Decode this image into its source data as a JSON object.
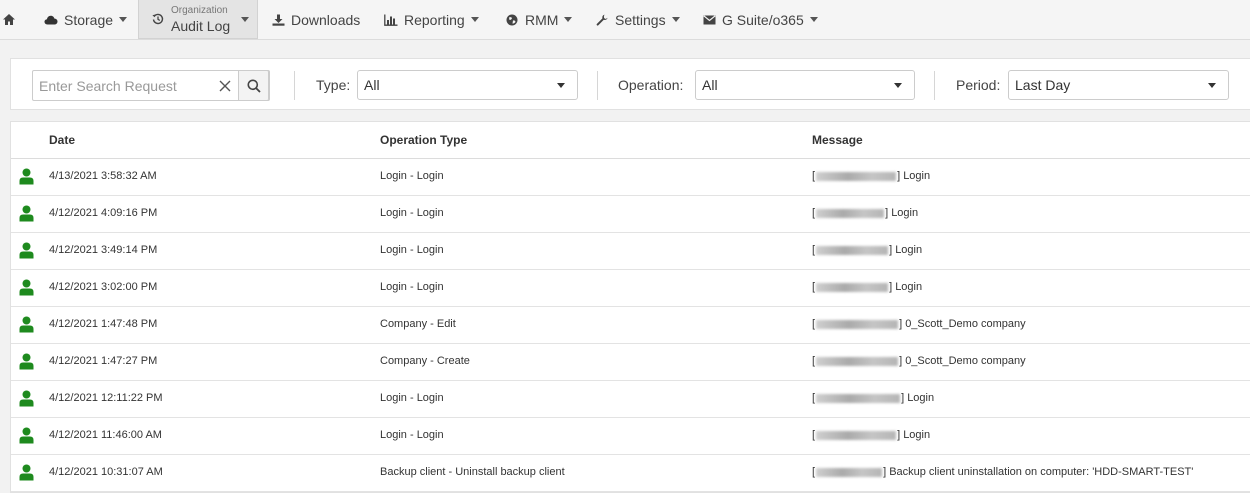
{
  "nav": {
    "storage": "Storage",
    "audit_log_top": "Organization",
    "audit_log_bottom": "Audit Log",
    "downloads": "Downloads",
    "reporting": "Reporting",
    "rmm": "RMM",
    "settings": "Settings",
    "gsuite": "G Suite/o365"
  },
  "filters": {
    "search_placeholder": "Enter Search Request",
    "search_value": "",
    "type_label": "Type:",
    "type_value": "All",
    "operation_label": "Operation:",
    "operation_value": "All",
    "period_label": "Period:",
    "period_value": "Last Day"
  },
  "table": {
    "headers": {
      "date": "Date",
      "operation": "Operation Type",
      "message": "Message"
    },
    "rows": [
      {
        "date": "4/13/2021 3:58:32 AM",
        "operation": "Login - Login",
        "message": "Login"
      },
      {
        "date": "4/12/2021 4:09:16 PM",
        "operation": "Login - Login",
        "message": "Login"
      },
      {
        "date": "4/12/2021 3:49:14 PM",
        "operation": "Login - Login",
        "message": "Login"
      },
      {
        "date": "4/12/2021 3:02:00 PM",
        "operation": "Login - Login",
        "message": "Login"
      },
      {
        "date": "4/12/2021 1:47:48 PM",
        "operation": "Company - Edit",
        "message": "0_Scott_Demo company"
      },
      {
        "date": "4/12/2021 1:47:27 PM",
        "operation": "Company - Create",
        "message": "0_Scott_Demo company"
      },
      {
        "date": "4/12/2021 12:11:22 PM",
        "operation": "Login - Login",
        "message": "Login"
      },
      {
        "date": "4/12/2021 11:46:00 AM",
        "operation": "Login - Login",
        "message": "Login"
      },
      {
        "date": "4/12/2021 10:31:07 AM",
        "operation": "Backup client - Uninstall backup client",
        "message": "Backup client uninstallation on computer: 'HDD-SMART-TEST'"
      }
    ]
  },
  "colors": {
    "user_icon": "#1e8a1e",
    "accent": "#444444"
  },
  "icons": {
    "home": "home-icon",
    "storage": "cloud-icon",
    "audit_log": "history-icon",
    "downloads": "download-icon",
    "reporting": "bar-chart-icon",
    "rmm": "globe-icon",
    "settings": "wrench-icon",
    "gsuite": "envelope-icon",
    "row": "user-icon"
  }
}
